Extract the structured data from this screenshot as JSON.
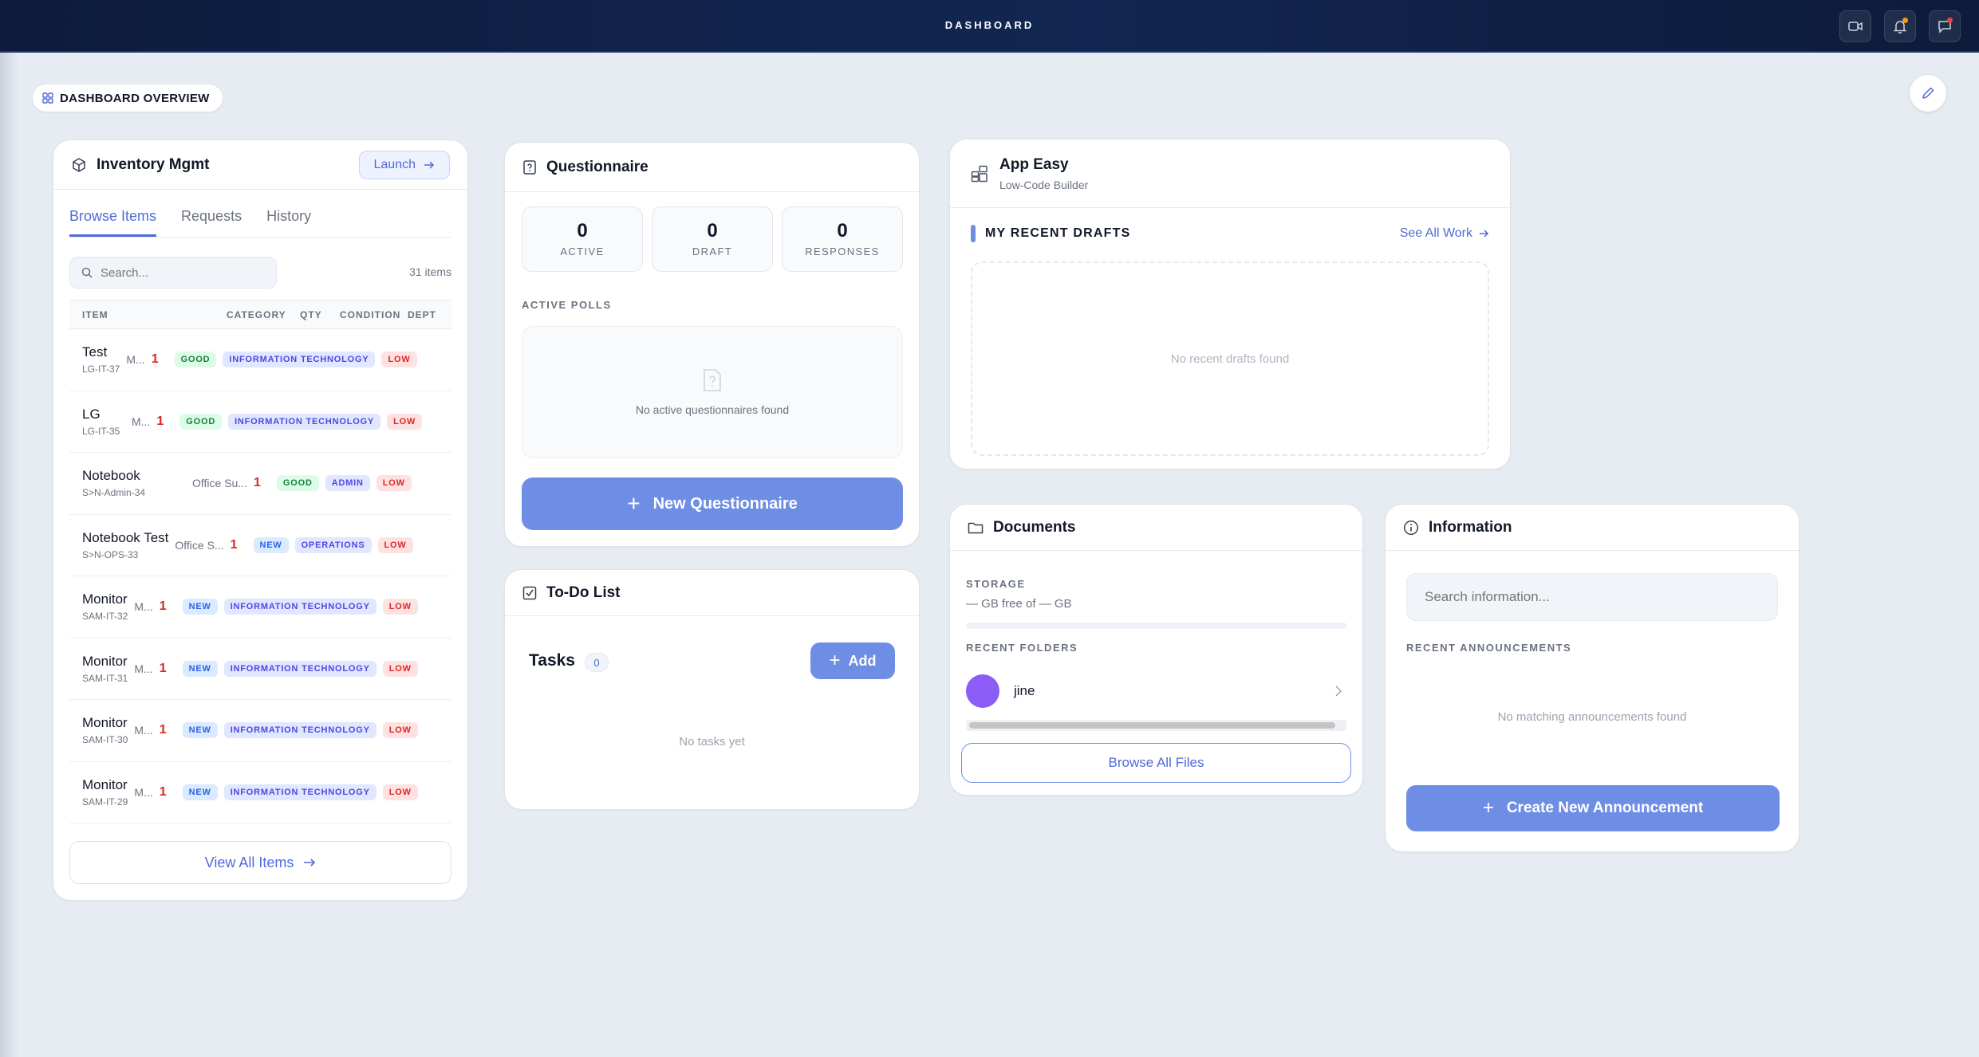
{
  "topbar": {
    "title": "DASHBOARD"
  },
  "overview": {
    "label": "DASHBOARD OVERVIEW"
  },
  "inventory": {
    "title": "Inventory Mgmt",
    "launch_label": "Launch",
    "tabs": [
      {
        "label": "Browse Items"
      },
      {
        "label": "Requests"
      },
      {
        "label": "History"
      }
    ],
    "search_placeholder": "Search...",
    "count": "31 items",
    "columns": {
      "item": "ITEM",
      "category": "CATEGORY",
      "qty": "QTY",
      "condition": "CONDITION",
      "dept": "DEPT"
    },
    "rows": [
      {
        "name": "Test",
        "code": "LG-IT-37",
        "category": "M...",
        "qty": "1",
        "condition": "GOOD",
        "dept": "INFORMATION TECHNOLOGY",
        "priority": "LOW"
      },
      {
        "name": "LG",
        "code": "LG-IT-35",
        "category": "M...",
        "qty": "1",
        "condition": "GOOD",
        "dept": "INFORMATION TECHNOLOGY",
        "priority": "LOW"
      },
      {
        "name": "Notebook",
        "code": "S>N-Admin-34",
        "category": "Office Su...",
        "qty": "1",
        "condition": "GOOD",
        "dept": "ADMIN",
        "priority": "LOW"
      },
      {
        "name": "Notebook Test",
        "code": "S>N-OPS-33",
        "category": "Office S...",
        "qty": "1",
        "condition": "NEW",
        "dept": "OPERATIONS",
        "priority": "LOW"
      },
      {
        "name": "Monitor",
        "code": "SAM-IT-32",
        "category": "M...",
        "qty": "1",
        "condition": "NEW",
        "dept": "INFORMATION TECHNOLOGY",
        "priority": "LOW"
      },
      {
        "name": "Monitor",
        "code": "SAM-IT-31",
        "category": "M...",
        "qty": "1",
        "condition": "NEW",
        "dept": "INFORMATION TECHNOLOGY",
        "priority": "LOW"
      },
      {
        "name": "Monitor",
        "code": "SAM-IT-30",
        "category": "M...",
        "qty": "1",
        "condition": "NEW",
        "dept": "INFORMATION TECHNOLOGY",
        "priority": "LOW"
      },
      {
        "name": "Monitor",
        "code": "SAM-IT-29",
        "category": "M...",
        "qty": "1",
        "condition": "NEW",
        "dept": "INFORMATION TECHNOLOGY",
        "priority": "LOW"
      }
    ],
    "view_all_label": "View All Items"
  },
  "questionnaire": {
    "title": "Questionnaire",
    "stats": [
      {
        "value": "0",
        "label": "ACTIVE"
      },
      {
        "value": "0",
        "label": "DRAFT"
      },
      {
        "value": "0",
        "label": "RESPONSES"
      }
    ],
    "section_label": "ACTIVE POLLS",
    "empty_text": "No active questionnaires found",
    "new_button": "New Questionnaire"
  },
  "todo": {
    "title": "To-Do List",
    "tasks_label": "Tasks",
    "tasks_count": "0",
    "add_label": "Add",
    "empty_text": "No tasks yet"
  },
  "app_easy": {
    "title": "App Easy",
    "subtitle": "Low-Code Builder",
    "section_label": "MY RECENT DRAFTS",
    "see_all": "See All Work",
    "empty_text": "No recent drafts found"
  },
  "documents": {
    "title": "Documents",
    "storage_label": "STORAGE",
    "storage_value": "— GB free of — GB",
    "folders_label": "RECENT FOLDERS",
    "folder_name": "jine",
    "browse_label": "Browse All Files"
  },
  "information": {
    "title": "Information",
    "search_placeholder": "Search information...",
    "section_label": "RECENT ANNOUNCEMENTS",
    "empty_text": "No matching announcements found",
    "create_label": "Create New Announcement"
  },
  "colors": {
    "accent": "#4f6bd8",
    "primary_button": "#6e8ee6",
    "topbar": "#0d1c3b"
  }
}
